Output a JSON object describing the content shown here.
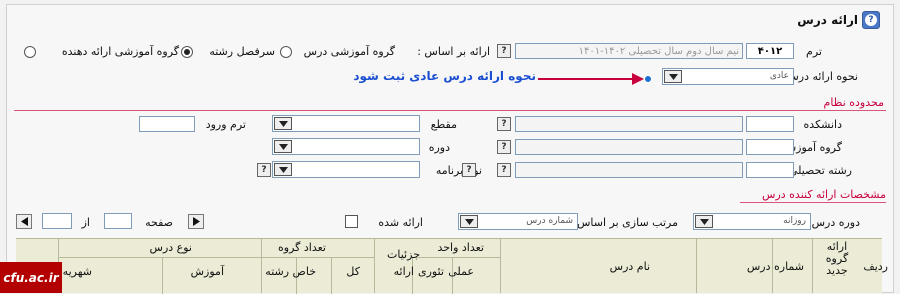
{
  "header": {
    "title": "ارائه درس"
  },
  "term": {
    "label": "ترم",
    "code": "۴۰۱۲",
    "name": "نیم سال دوم سال تحصیلی ۱۴۰۲-۱۴۰۱"
  },
  "offer_basis": {
    "label": "ارائه بر اساس :",
    "options": [
      "گروه آموزشی درس",
      "سرفصل رشته",
      "گروه آموزشی ارائه دهنده"
    ],
    "selected": "سرفصل رشته"
  },
  "offer_method": {
    "label": "نحوه ارائه درس",
    "value": "عادی",
    "annotation": "نحوه ارائه درس عادی ثبت شود"
  },
  "section_system_limits": "محدوده نظام",
  "faculty": {
    "label": "دانشکده"
  },
  "level": {
    "label": "مقطع"
  },
  "entry_term": {
    "label": "ترم ورود"
  },
  "edu_group": {
    "label": "گروه آموزشی"
  },
  "period": {
    "label": "دوره"
  },
  "field": {
    "label": "رشته تحصیلی"
  },
  "program_type": {
    "label": "نوع برنامه"
  },
  "section_provider": "مشخصات ارائه کننده درس",
  "course_period": {
    "label": "دوره درس",
    "value": "روزانه"
  },
  "sort": {
    "label": "مرتب سازی بر اساس",
    "value": "شماره درس"
  },
  "offered": {
    "label": "ارائه شده"
  },
  "pager": {
    "page_label": "صفحه",
    "of_label": "از"
  },
  "table": {
    "row": "ردیف",
    "new_group": "ارائه گروه جدید",
    "course_number": "شماره درس",
    "course_name": "نام درس",
    "units": "تعداد واحد",
    "theory": "تئوری",
    "practical": "عملی",
    "details": "جزئیات",
    "offer": "ارائه",
    "group_count": "تعداد گروه",
    "total": "کل",
    "specific_field": "خاص رشته",
    "course_type": "نوع درس",
    "education": "آموزش",
    "tuition": "شهریه"
  },
  "logo": {
    "text": "cfu.ac.ir"
  },
  "colors": {
    "accent_red": "#c8003c",
    "annotation_blue": "#1a6fd1",
    "grid_header": "#ebebd6"
  }
}
